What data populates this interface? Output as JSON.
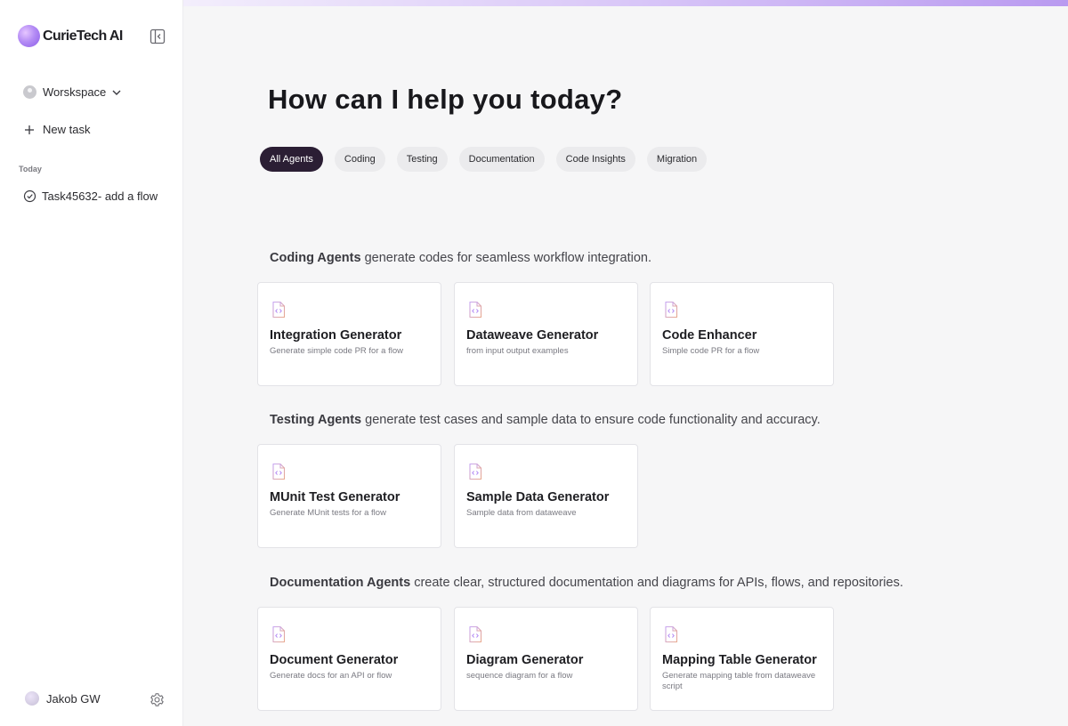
{
  "app": {
    "name": "CurieTech AI"
  },
  "sidebar": {
    "workspace_label": "Worskspace",
    "new_task_label": "New task",
    "section_today": "Today",
    "tasks": [
      {
        "label": "Task45632- add a flow"
      }
    ],
    "user_name": "Jakob GW"
  },
  "main": {
    "headline": "How can I help you today?",
    "filters": [
      {
        "label": "All Agents",
        "active": true
      },
      {
        "label": "Coding",
        "active": false
      },
      {
        "label": "Testing",
        "active": false
      },
      {
        "label": "Documentation",
        "active": false
      },
      {
        "label": "Code Insights",
        "active": false
      },
      {
        "label": "Migration",
        "active": false
      }
    ],
    "sections": [
      {
        "title": "Coding Agents",
        "subtitle": "generate codes for seamless workflow integration.",
        "agents": [
          {
            "title": "Integration Generator",
            "desc": "Generate simple code PR for a flow"
          },
          {
            "title": "Dataweave Generator",
            "desc": "from input output examples"
          },
          {
            "title": "Code Enhancer",
            "desc": "Simple code PR for a flow"
          }
        ]
      },
      {
        "title": "Testing Agents",
        "subtitle": "generate test cases and sample data to ensure code functionality and accuracy.",
        "agents": [
          {
            "title": "MUnit Test Generator",
            "desc": "Generate MUnit tests for a flow"
          },
          {
            "title": "Sample Data Generator",
            "desc": "Sample data from dataweave"
          }
        ]
      },
      {
        "title": "Documentation Agents",
        "subtitle": "create clear, structured documentation and diagrams for APIs, flows, and repositories.",
        "agents": [
          {
            "title": "Document Generator",
            "desc": "Generate docs for an API or flow"
          },
          {
            "title": "Diagram Generator",
            "desc": "sequence diagram for a flow"
          },
          {
            "title": "Mapping Table Generator",
            "desc": "Generate mapping table from dataweave script"
          }
        ]
      }
    ]
  },
  "icons": {
    "logo": "logo-orb-icon",
    "collapse": "sidebar-collapse-icon",
    "settings": "gear-icon",
    "agent": "code-file-icon"
  },
  "colors": {
    "accent": "#8c5ee8",
    "active_chip": "#2b1e34",
    "background": "#f6f6f7"
  }
}
